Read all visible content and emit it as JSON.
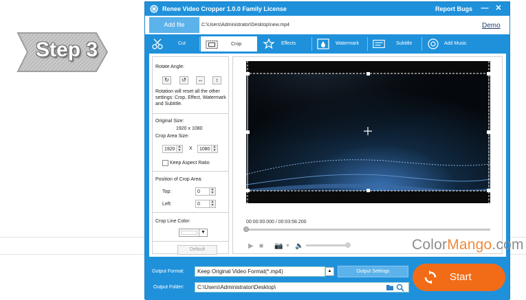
{
  "step_badge": {
    "text": "Step 3"
  },
  "app": {
    "title": "Renee Video Cropper 1.0.0 Family License",
    "report_bugs": "Report Bugs",
    "add_file": "Add file",
    "file_path": "C:\\Users\\Administrator\\Desktop\\new.mp4",
    "demo": "Demo",
    "tabs": [
      {
        "label": "Cut",
        "icon": "cut-icon"
      },
      {
        "label": "Crop",
        "icon": "crop-icon"
      },
      {
        "label": "Effects",
        "icon": "effects-icon"
      },
      {
        "label": "Watermark",
        "icon": "watermark-icon"
      },
      {
        "label": "Subtitle",
        "icon": "subtitle-icon"
      },
      {
        "label": "Add Music",
        "icon": "music-icon"
      }
    ],
    "active_tab": "Crop"
  },
  "left_panel": {
    "rotate_angle": "Rotate Angle:",
    "rotate_note": "Rotation will reset all the other settings: Crop, Effect, Watermark and Subtitle.",
    "original_size_label": "Original Size:",
    "original_size_value": "1920 x 1080",
    "crop_area_size_label": "Crop Area Size:",
    "crop_width": "1920",
    "crop_height": "1080",
    "crop_x": "X",
    "keep_aspect": "Keep Aspect Ratio",
    "position_label": "Position of Crop Area:",
    "top_label": "Top:",
    "top_value": "0",
    "left_label": "Left:",
    "left_value": "0",
    "crop_line_color": "Crop Line Color:",
    "crop_line_color_value": "#ffffff",
    "default_button": "Default"
  },
  "preview": {
    "time": "00:00:00.000 / 00:03:58.200",
    "progress": 0.0,
    "volume": 1.0
  },
  "bottom": {
    "output_format_label": "Output Format:",
    "output_format_value": "Keep Original Video Format(*.mp4)",
    "output_settings": "Output Settings",
    "output_folder_label": "Output Folder:",
    "output_folder_value": "C:\\Users\\Administrator\\Desktop\\",
    "start": "Start"
  },
  "watermark": {
    "part1": "Color",
    "part2": "Mango",
    "part3": ".com"
  },
  "colors": {
    "brand_blue": "#1f91db",
    "start_orange": "#f26c17",
    "watermark_orange": "#f08a3a"
  }
}
